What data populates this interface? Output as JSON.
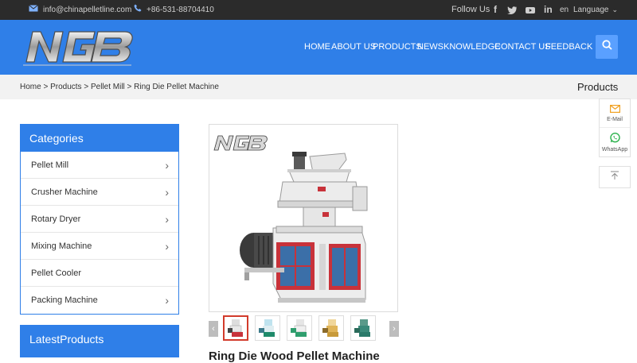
{
  "topbar": {
    "email": "info@chinapelletline.com",
    "phone": "+86-531-88704410",
    "follow_label": "Follow Us",
    "social": [
      "f",
      "twitter",
      "youtube",
      "in"
    ],
    "lang_code": "en",
    "language_label": "Language"
  },
  "header": {
    "logo_text": "NGB",
    "nav": [
      "HOME",
      "ABOUT US",
      "PRODUCTS",
      "NEWS",
      "KNOWLEDGE",
      "CONTACT US",
      "FEEDBACK"
    ]
  },
  "breadcrumb": {
    "items": [
      "Home",
      "Products",
      "Pellet Mill",
      "Ring Die Pellet Machine"
    ],
    "separator": ">",
    "section_title": "Products"
  },
  "float": {
    "email_label": "E-Mail",
    "whatsapp_label": "WhatsApp"
  },
  "categories": {
    "title": "Categories",
    "items": [
      {
        "label": "Pellet Mill",
        "has_sub": true
      },
      {
        "label": "Crusher Machine",
        "has_sub": true
      },
      {
        "label": "Rotary Dryer",
        "has_sub": true
      },
      {
        "label": "Mixing Machine",
        "has_sub": true
      },
      {
        "label": "Pellet Cooler",
        "has_sub": false
      },
      {
        "label": "Packing Machine",
        "has_sub": true
      }
    ]
  },
  "latest": {
    "title": "LatestProducts"
  },
  "product": {
    "logo_text": "NGB",
    "title_partial": "Ring Die Wood Pellet Machine",
    "thumb_count": 5
  },
  "colors": {
    "brand_blue": "#2f7fe8",
    "topbar": "#2b2b2b",
    "machine_red": "#c8323a"
  }
}
